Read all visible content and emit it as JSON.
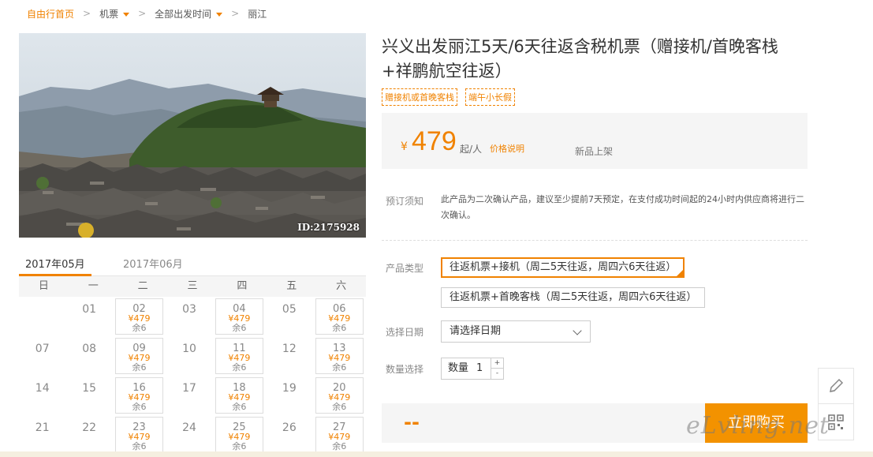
{
  "breadcrumb": {
    "home": "自由行首页",
    "flights": "机票",
    "departure": "全部出发时间",
    "destination": "丽江"
  },
  "photo": {
    "id_label": "ID:2175928"
  },
  "calendar": {
    "tabs": [
      "2017年05月",
      "2017年06月"
    ],
    "weekdays": [
      "日",
      "一",
      "二",
      "三",
      "四",
      "五",
      "六"
    ],
    "price_text": "¥479",
    "stock_text": "余6",
    "rows": [
      [
        {
          "day": ""
        },
        {
          "day": "01"
        },
        {
          "day": "02",
          "avail": true
        },
        {
          "day": "03"
        },
        {
          "day": "04",
          "avail": true
        },
        {
          "day": "05"
        },
        {
          "day": "06",
          "avail": true
        }
      ],
      [
        {
          "day": "07"
        },
        {
          "day": "08"
        },
        {
          "day": "09",
          "avail": true
        },
        {
          "day": "10"
        },
        {
          "day": "11",
          "avail": true
        },
        {
          "day": "12"
        },
        {
          "day": "13",
          "avail": true
        }
      ],
      [
        {
          "day": "14"
        },
        {
          "day": "15"
        },
        {
          "day": "16",
          "avail": true
        },
        {
          "day": "17"
        },
        {
          "day": "18",
          "avail": true
        },
        {
          "day": "19"
        },
        {
          "day": "20",
          "avail": true
        }
      ],
      [
        {
          "day": "21"
        },
        {
          "day": "22"
        },
        {
          "day": "23",
          "avail": true
        },
        {
          "day": "24"
        },
        {
          "day": "25",
          "avail": true
        },
        {
          "day": "26"
        },
        {
          "day": "27",
          "avail": true
        }
      ]
    ]
  },
  "product": {
    "title_line1": "兴义出发丽江5天/6天往返含税机票（赠接机/首晚客栈",
    "title_line2": "+祥鹏航空往返）",
    "tags": [
      "赠接机或首晚客栈",
      "端午小长假"
    ]
  },
  "price": {
    "currency": "¥",
    "amount": "479",
    "unit": "起/人",
    "explain_link": "价格说明",
    "new_label": "新品上架"
  },
  "booking": {
    "notice_label": "预订须知",
    "notice_text": "此产品为二次确认产品，建议至少提前7天预定，在支付成功时间起的24小时内供应商将进行二次确认。",
    "type_label": "产品类型",
    "type_options": [
      "往返机票+接机（周二5天往返，周四六6天往返）",
      "往返机票+首晚客栈（周二5天往返，周四六6天往返）"
    ],
    "date_label": "选择日期",
    "date_placeholder": "请选择日期",
    "qty_label": "数量选择",
    "qty_prefix": "数量",
    "qty_value": "1",
    "qty_plus": "+",
    "qty_minus": "-",
    "total": "--",
    "buy_label": "立即购买"
  },
  "watermark": "eLvling.net",
  "colors": {
    "accent": "#f08200",
    "button": "#f39200"
  }
}
